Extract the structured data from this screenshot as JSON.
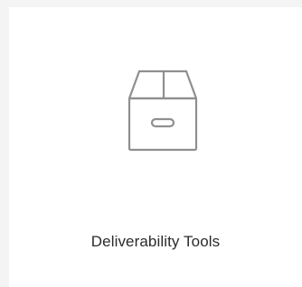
{
  "card": {
    "icon": "archive-box-icon",
    "label": "Deliverability Tools"
  },
  "colors": {
    "page_background": "#f4f4f4",
    "card_background": "#ffffff",
    "icon_stroke": "#8f8f8f",
    "label_text": "#2b2b2b"
  }
}
